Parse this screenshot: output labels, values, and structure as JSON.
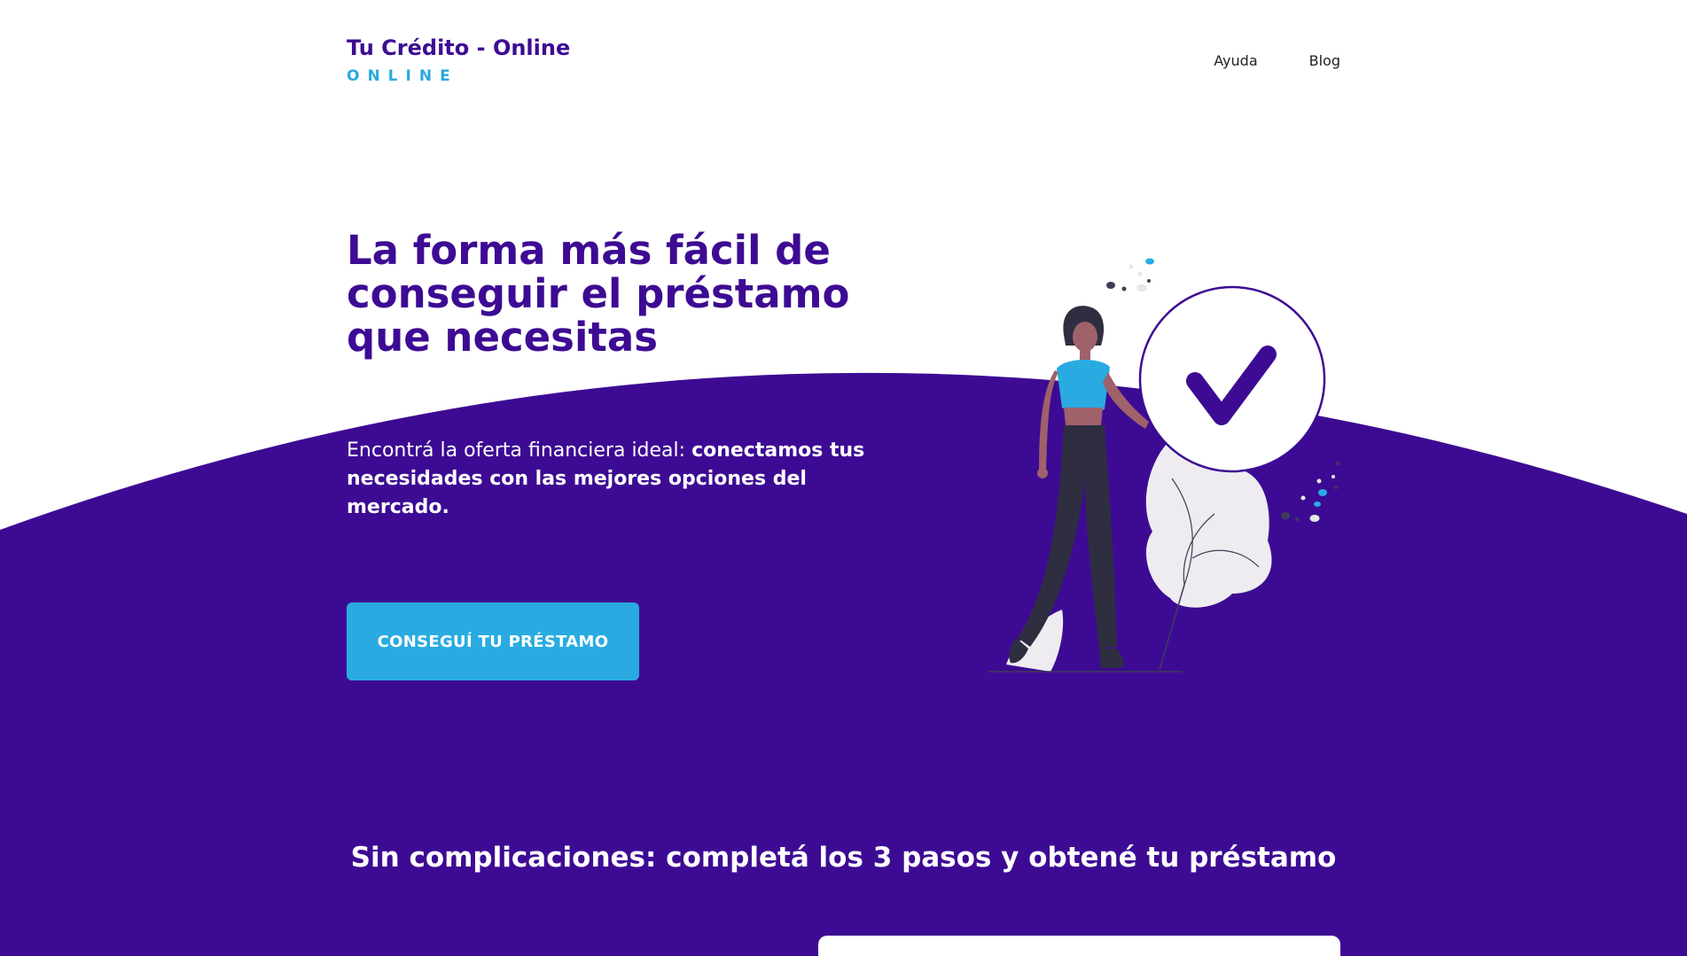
{
  "brand": {
    "title": "Tu Crédito - Online",
    "subtitle": "ONLINE"
  },
  "nav": {
    "items": [
      {
        "label": "Ayuda"
      },
      {
        "label": "Blog"
      }
    ]
  },
  "hero": {
    "title": "La forma más fácil de conseguir el préstamo que necesitas",
    "subtitle_regular": "Encontrá la oferta financiera ideal: ",
    "subtitle_bold": "conectamos tus necesidades con las mejores opciones del mercado.",
    "cta_label": "CONSEGUÍ TU PRÉSTAMO"
  },
  "steps": {
    "title": "Sin complicaciones: completá los 3 pasos y obtené tu préstamo"
  },
  "colors": {
    "primary": "#3d0b93",
    "accent": "#29abe2",
    "background": "#ffffff"
  },
  "illustration": {
    "icon": "woman-with-checkmark-illustration"
  }
}
